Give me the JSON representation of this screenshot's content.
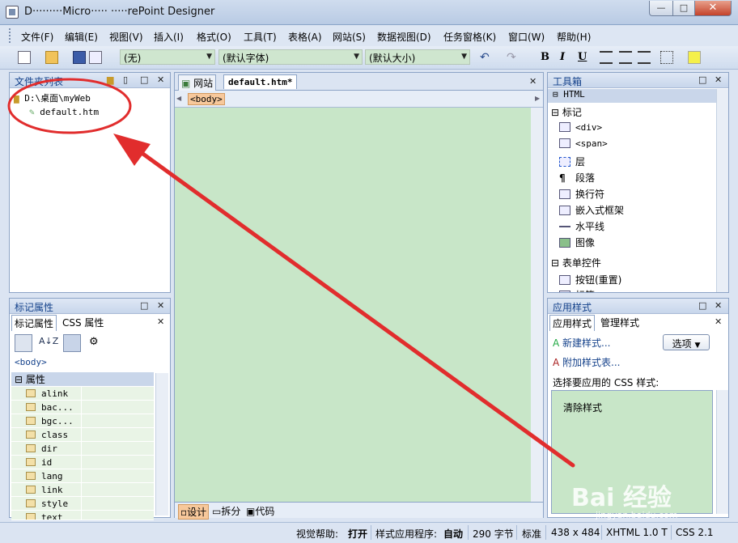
{
  "window": {
    "title": "D·········Micro····· ·····rePoint Designer",
    "min": "—",
    "max": "□",
    "close": "✕"
  },
  "menu": [
    "文件(F)",
    "编辑(E)",
    "视图(V)",
    "插入(I)",
    "格式(O)",
    "工具(T)",
    "表格(A)",
    "网站(S)",
    "数据视图(D)",
    "任务窗格(K)",
    "窗口(W)",
    "帮助(H)"
  ],
  "toolbar": {
    "style": "(无)",
    "font": "(默认字体)",
    "size": "(默认大小)",
    "bold": "B",
    "italic": "I",
    "underline": "U"
  },
  "folder_list": {
    "title": "文件夹列表",
    "root": "D:\\桌面\\myWeb",
    "file": "default.htm"
  },
  "tag_props": {
    "title": "标记属性",
    "tab1": "标记属性",
    "tab2": "CSS 属性",
    "tag": "<body>",
    "section": "属性",
    "props": [
      "alink",
      "bac...",
      "bgc...",
      "class",
      "dir",
      "id",
      "lang",
      "link",
      "style",
      "text"
    ]
  },
  "editor": {
    "tab_site": "网站",
    "tab_doc": "default.htm*",
    "tag_chip": "<body>",
    "view_design": "设计",
    "view_split": "拆分",
    "view_code": "代码"
  },
  "toolbox": {
    "title": "工具箱",
    "html": "HTML",
    "tags_header": "标记",
    "tags": [
      "<div>",
      "<span>",
      "层",
      "段落",
      "换行符",
      "嵌入式框架",
      "水平线",
      "图像"
    ],
    "forms_header": "表单控件",
    "forms": [
      "按钮(重置)",
      "标签"
    ]
  },
  "apply_styles": {
    "title": "应用样式",
    "tab1": "应用样式",
    "tab2": "管理样式",
    "new_style": "新建样式...",
    "attach": "附加样式表...",
    "options": "选项",
    "select_label": "选择要应用的 CSS 样式:",
    "clear": "清除样式"
  },
  "status": {
    "visual_help_label": "视觉帮助:",
    "visual_help": "打开",
    "style_app_label": "样式应用程序:",
    "style_app": "自动",
    "bytes": "290 字节",
    "mode": "标准",
    "dims": "438 x 484",
    "doctype": "XHTML 1.0 T",
    "css": "CSS 2.1"
  },
  "watermark": {
    "logo": "Bai 经验",
    "url": "jingyan.baidu.com"
  }
}
